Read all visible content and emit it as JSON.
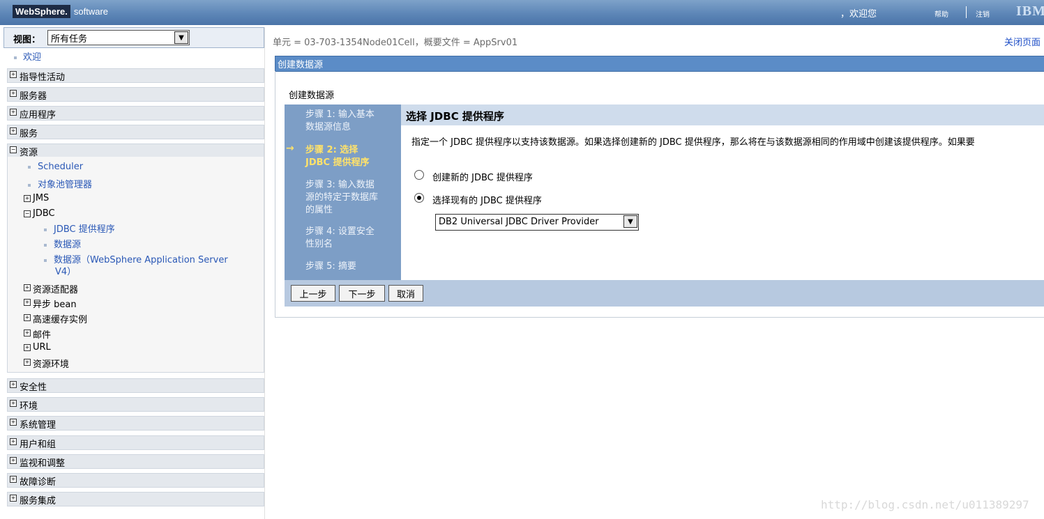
{
  "banner": {
    "brand_main": "WebSphere.",
    "brand_sub": "software",
    "welcome": "，欢迎您",
    "help": "帮助",
    "logout": "注销",
    "ibm": "IBM"
  },
  "nav": {
    "view_label": "视图：",
    "view_value": "所有任务",
    "welcome_link": "欢迎",
    "sections_top": [
      "指导性活动",
      "服务器",
      "应用程序",
      "服务"
    ],
    "resources": "资源",
    "resource_items": {
      "scheduler": "Scheduler",
      "pool_manager": "对象池管理器",
      "jms": "JMS",
      "jdbc": "JDBC",
      "jdbc_providers": "JDBC 提供程序",
      "datasources": "数据源",
      "datasources_v4_line1": "数据源（WebSphere Application Server",
      "datasources_v4_line2": "V4）",
      "adapters": "资源适配器",
      "async": "异步 bean",
      "cache": "高速缓存实例",
      "mail": "邮件",
      "url": "URL",
      "env": "资源环境"
    },
    "sections_bottom": [
      "安全性",
      "环境",
      "系统管理",
      "用户和组",
      "监视和调整",
      "故障诊断",
      "服务集成"
    ]
  },
  "main": {
    "crumb": "单元 = 03-703-1354Node01Cell，概要文件 = AppSrv01",
    "close_page": "关闭页面",
    "title": "创建数据源",
    "panel_title": "创建数据源",
    "steps": {
      "s1_l1": "步骤 1: 输入基本",
      "s1_l2": "数据源信息",
      "s2_l1": "步骤 2: 选择",
      "s2_l2": "JDBC 提供程序",
      "s3_l1": "步骤 3: 输入数据",
      "s3_l2": "源的特定于数据库",
      "s3_l3": "的属性",
      "s4_l1": "步骤 4: 设置安全",
      "s4_l2": "性别名",
      "s5_l1": "步骤 5: 摘要",
      "arrow": "→"
    },
    "section_title": "选择 JDBC 提供程序",
    "description": "指定一个 JDBC 提供程序以支持该数据源。如果选择创建新的 JDBC 提供程序，那么将在与该数据源相同的作用域中创建该提供程序。如果要",
    "option_new": "创建新的 JDBC 提供程序",
    "option_existing": "选择现有的 JDBC 提供程序",
    "selected_option": "existing",
    "provider_value": "DB2 Universal JDBC Driver Provider",
    "buttons": {
      "prev": "上一步",
      "next": "下一步",
      "cancel": "取消"
    }
  },
  "watermark": "http://blog.csdn.net/u011389297",
  "colors": {
    "banner": "#5d86b7",
    "title_bar": "#5b8cc7",
    "steps_bg": "#7d9ec6",
    "current_step": "#ffe26a",
    "link": "#2a58b6"
  }
}
